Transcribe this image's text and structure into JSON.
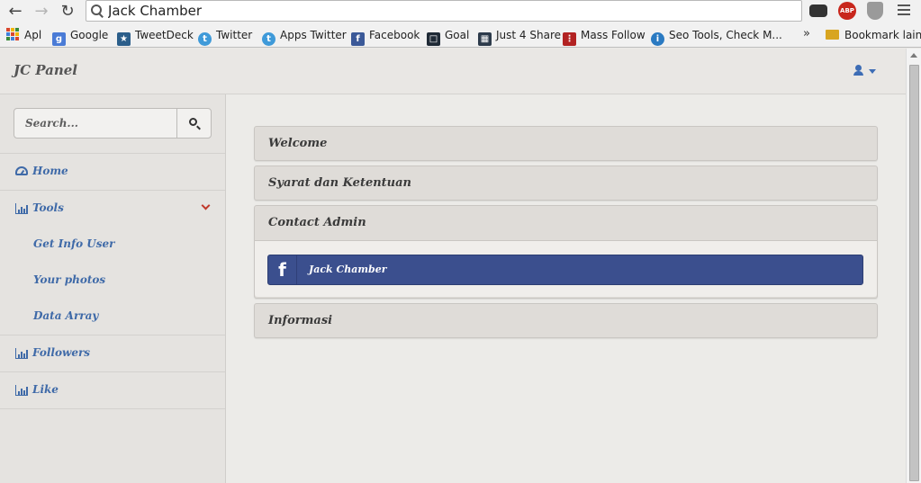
{
  "browser": {
    "address": "Jack Chamber",
    "extensions": {
      "abp": "ABP"
    },
    "bookmarks": [
      {
        "label": "Apl",
        "icon": "apps-grid-icon"
      },
      {
        "label": "Google",
        "icon": "google-icon",
        "color": "#4a7bd6"
      },
      {
        "label": "TweetDeck",
        "icon": "tweetdeck-icon",
        "color": "#2b5e8a"
      },
      {
        "label": "Twitter",
        "icon": "twitter-bird-icon",
        "color": "#3f9ad9"
      },
      {
        "label": "Apps Twitter",
        "icon": "twitter-bird-icon",
        "color": "#3f9ad9"
      },
      {
        "label": "Facebook",
        "icon": "facebook-icon",
        "color": "#3b5998"
      },
      {
        "label": "Goal",
        "icon": "goal-icon",
        "color": "#1f2a36"
      },
      {
        "label": "Just 4 Share",
        "icon": "just4share-icon",
        "color": "#2d3b4b"
      },
      {
        "label": "Mass Follow",
        "icon": "massfollow-icon",
        "color": "#b22222"
      },
      {
        "label": "Seo Tools, Check M...",
        "icon": "info-icon",
        "color": "#2a7ac2"
      }
    ],
    "overflow": "»",
    "other_bookmarks": "Bookmark lain"
  },
  "app": {
    "brand": "JC Panel",
    "search_placeholder": "Search...",
    "sidebar": [
      {
        "label": "Home",
        "icon": "dashboard-icon"
      },
      {
        "label": "Tools",
        "icon": "bar-chart-icon",
        "expanded": true,
        "children": [
          {
            "label": "Get Info User"
          },
          {
            "label": "Your photos"
          },
          {
            "label": "Data Array"
          }
        ]
      },
      {
        "label": "Followers",
        "icon": "bar-chart-icon"
      },
      {
        "label": "Like",
        "icon": "bar-chart-icon"
      }
    ],
    "panels": [
      {
        "title": "Welcome"
      },
      {
        "title": "Syarat dan Ketentuan"
      },
      {
        "title": "Contact Admin",
        "expanded": true,
        "button": {
          "label": "Jack Chamber",
          "icon": "facebook-icon",
          "color": "#3b4f8e"
        }
      },
      {
        "title": "Informasi"
      }
    ]
  }
}
